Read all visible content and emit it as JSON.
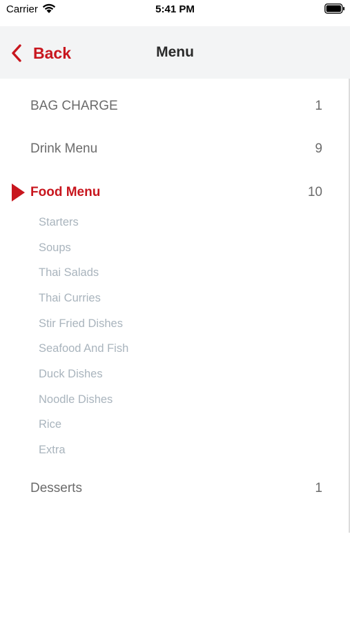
{
  "status_bar": {
    "carrier": "Carrier",
    "time": "5:41 PM",
    "icons": [
      "wifi-icon",
      "battery-icon"
    ]
  },
  "nav": {
    "back_label": "Back",
    "title": "Menu",
    "back_icon": "chevron-left-icon"
  },
  "colors": {
    "accent": "#c8161e",
    "text": "#6b6b6b",
    "subtext": "#a9b4bd",
    "nav_bg": "#f3f4f5"
  },
  "categories": [
    {
      "label": "BAG CHARGE",
      "count": "1"
    },
    {
      "label": "Drink Menu",
      "count": "9"
    },
    {
      "label": "Food Menu",
      "count": "10",
      "active": true,
      "subcategories": [
        "Starters",
        "Soups",
        "Thai Salads",
        "Thai Curries",
        "Stir Fried Dishes",
        "Seafood And Fish",
        "Duck Dishes",
        "Noodle Dishes",
        "Rice",
        "Extra"
      ]
    },
    {
      "label": "Desserts",
      "count": "1"
    }
  ]
}
